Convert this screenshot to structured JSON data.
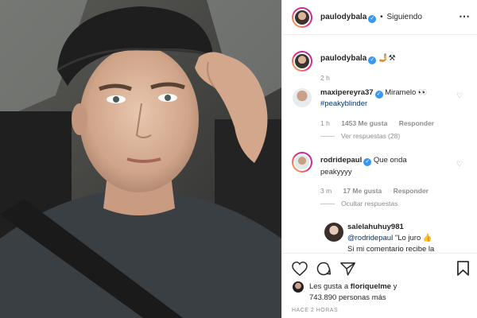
{
  "header": {
    "username": "paulodybala",
    "separator": "•",
    "follow_state": "Siguiendo",
    "more_icon": "more-dots-icon"
  },
  "caption": {
    "username": "paulodybala",
    "emojis": "🤳⚒",
    "time": "2 h"
  },
  "comments": [
    {
      "username": "maxipereyra37",
      "text": "Miramelo 👀",
      "hashtag": "#peakyblinder",
      "time": "1 h",
      "likes": "1453 Me gusta",
      "reply_label": "Responder",
      "replies_toggle": "Ver respuestas (28)"
    },
    {
      "username": "rodridepaul",
      "text": "Que onda",
      "text2": "peakyyyy",
      "time": "3 m",
      "likes": "17 Me gusta",
      "reply_label": "Responder",
      "replies_toggle": "Ocultar respuestas"
    }
  ],
  "reply": {
    "username": "salelahuhuy981",
    "mention": "@rodridepaul",
    "text": "\"Lo juro 👍",
    "text2": "Si mi comentario recibe la"
  },
  "likes": {
    "prefix": "Les gusta a",
    "liker": "floriquelme",
    "conj": "y",
    "count": "743.890 personas más"
  },
  "posted": "HACE 2 HORAS",
  "colors": {
    "verified": "#3897f0",
    "link": "#003569",
    "muted": "#8e8e8e",
    "border": "#efefef"
  }
}
